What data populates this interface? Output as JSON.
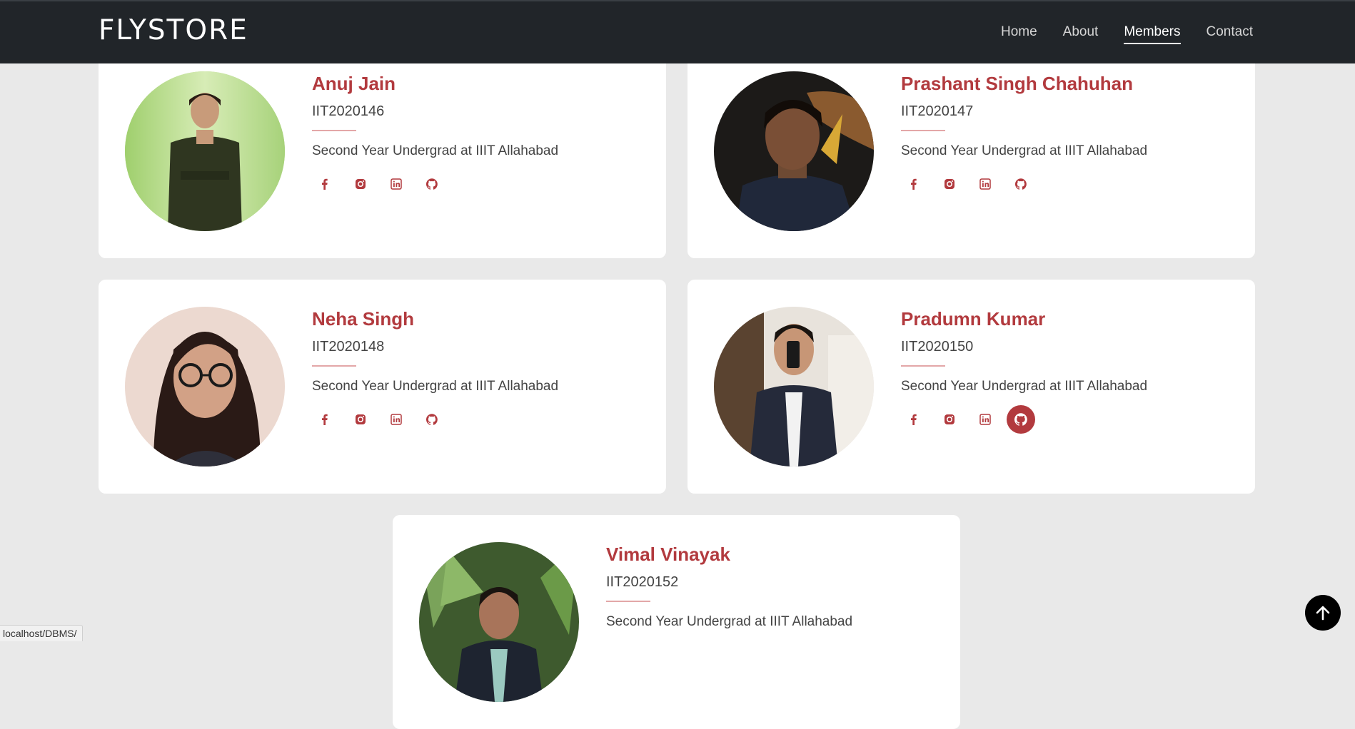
{
  "navbar": {
    "brand": "FLYSTORE",
    "links": [
      "Home",
      "About",
      "Members",
      "Contact"
    ],
    "active": "Members"
  },
  "members": [
    {
      "name": "Anuj Jain",
      "roll": "IIT2020146",
      "description": "Second Year Undergrad at IIIT Allahabad"
    },
    {
      "name": "Prashant Singh Chahuhan",
      "roll": "IIT2020147",
      "description": "Second Year Undergrad at IIIT Allahabad"
    },
    {
      "name": "Neha Singh",
      "roll": "IIT2020148",
      "description": "Second Year Undergrad at IIIT Allahabad"
    },
    {
      "name": "Pradumn Kumar",
      "roll": "IIT2020150",
      "description": "Second Year Undergrad at IIIT Allahabad"
    },
    {
      "name": "Vimal Vinayak",
      "roll": "IIT2020152",
      "description": "Second Year Undergrad at IIIT Allahabad"
    }
  ],
  "social_icons": [
    "facebook-icon",
    "instagram-icon",
    "linkedin-icon",
    "github-icon"
  ],
  "hovered_social": {
    "member": "Pradumn Kumar",
    "icon": "github-icon"
  },
  "status_bar": {
    "url": "localhost/DBMS/"
  },
  "colors": {
    "navbar_bg": "#212529",
    "accent": "#b23a3e",
    "page_bg": "#e9e9e9",
    "card_bg": "#ffffff"
  }
}
